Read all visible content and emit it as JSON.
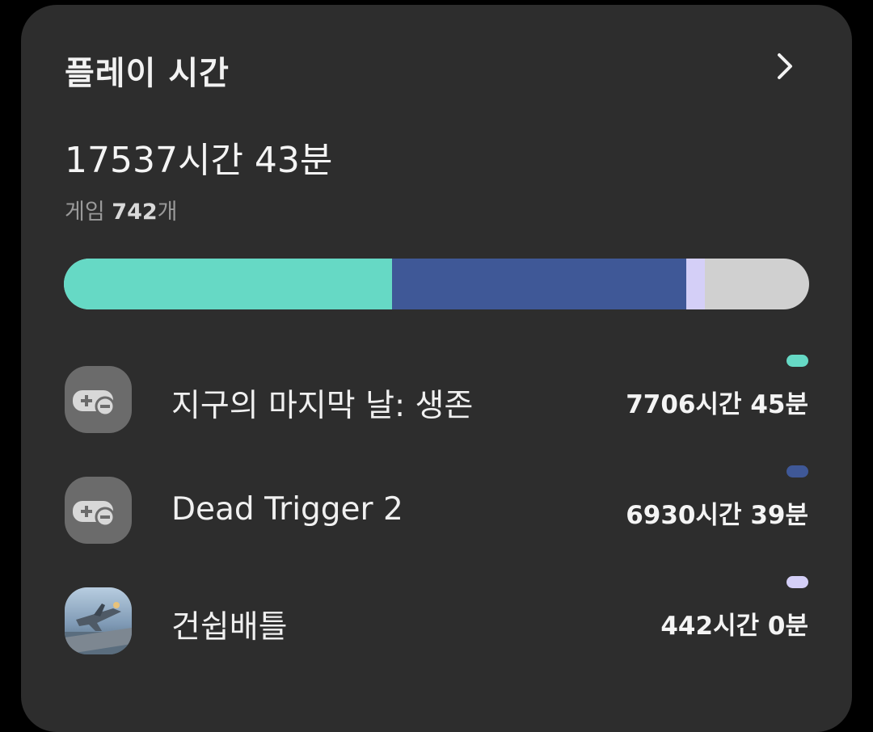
{
  "header": {
    "title": "플레이 시간",
    "chevron_icon": "chevron-right-icon"
  },
  "summary": {
    "total_time": "17537시간 43분",
    "game_count_label": "게임",
    "game_count_value": "742",
    "game_count_unit": "개"
  },
  "usage_bar": {
    "background_color": "#d0d0d0",
    "segments": [
      {
        "name": "지구의 마지막 날: 생존",
        "fraction": 0.44,
        "color": "#66d9c5"
      },
      {
        "name": "Dead Trigger 2",
        "fraction": 0.395,
        "color": "#3f5897"
      },
      {
        "name": "건쉽배틀",
        "fraction": 0.025,
        "color": "#d4cff7"
      }
    ]
  },
  "apps": [
    {
      "name": "지구의 마지막 날: 생존",
      "time": "7706시간 45분",
      "color": "#66d9c5",
      "icon": "gamepad-icon"
    },
    {
      "name": "Dead Trigger 2",
      "time": "6930시간 39분",
      "color": "#3f5897",
      "icon": "gamepad-icon"
    },
    {
      "name": "건쉽배틀",
      "time": "442시간 0분",
      "color": "#d4cff7",
      "icon": "gunship-battle-app-icon"
    }
  ]
}
